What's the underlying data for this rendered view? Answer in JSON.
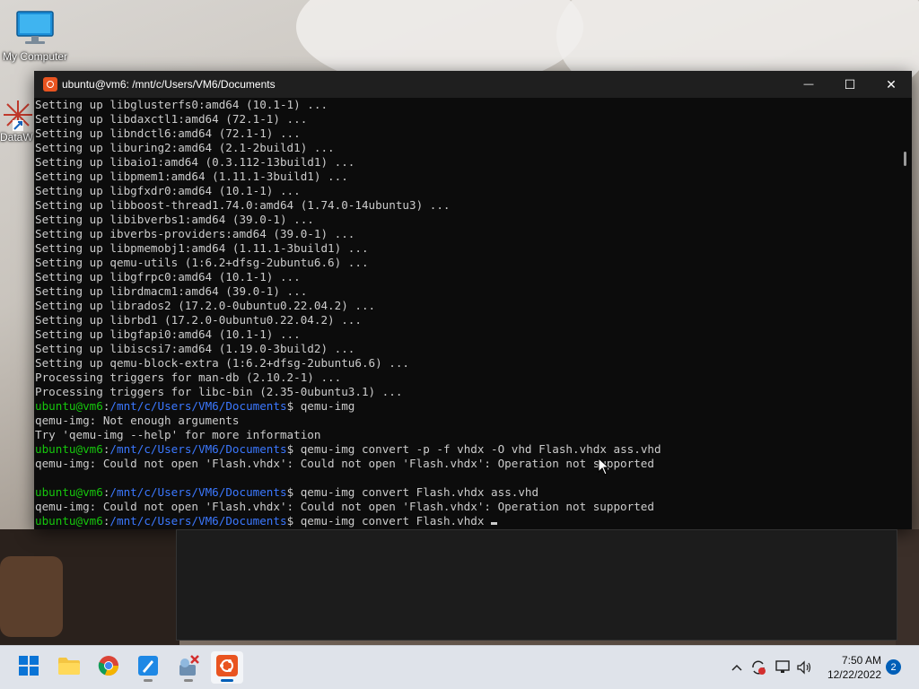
{
  "desktop": {
    "icons": [
      {
        "label": "My Computer",
        "icon": "monitor-icon"
      },
      {
        "label": "DataW",
        "icon": "app-shortcut-icon"
      }
    ]
  },
  "terminal": {
    "title": "ubuntu@vm6: /mnt/c/Users/VM6/Documents",
    "controls": {
      "minimize": "—",
      "maximize": "☐",
      "close": "✕"
    },
    "lines": [
      {
        "text": "Setting up libglusterfs0:amd64 (10.1-1) ..."
      },
      {
        "text": "Setting up libdaxctl1:amd64 (72.1-1) ..."
      },
      {
        "text": "Setting up libndctl6:amd64 (72.1-1) ..."
      },
      {
        "text": "Setting up liburing2:amd64 (2.1-2build1) ..."
      },
      {
        "text": "Setting up libaio1:amd64 (0.3.112-13build1) ..."
      },
      {
        "text": "Setting up libpmem1:amd64 (1.11.1-3build1) ..."
      },
      {
        "text": "Setting up libgfxdr0:amd64 (10.1-1) ..."
      },
      {
        "text": "Setting up libboost-thread1.74.0:amd64 (1.74.0-14ubuntu3) ..."
      },
      {
        "text": "Setting up libibverbs1:amd64 (39.0-1) ..."
      },
      {
        "text": "Setting up ibverbs-providers:amd64 (39.0-1) ..."
      },
      {
        "text": "Setting up libpmemobj1:amd64 (1.11.1-3build1) ..."
      },
      {
        "text": "Setting up qemu-utils (1:6.2+dfsg-2ubuntu6.6) ..."
      },
      {
        "text": "Setting up libgfrpc0:amd64 (10.1-1) ..."
      },
      {
        "text": "Setting up librdmacm1:amd64 (39.0-1) ..."
      },
      {
        "text": "Setting up librados2 (17.2.0-0ubuntu0.22.04.2) ..."
      },
      {
        "text": "Setting up librbd1 (17.2.0-0ubuntu0.22.04.2) ..."
      },
      {
        "text": "Setting up libgfapi0:amd64 (10.1-1) ..."
      },
      {
        "text": "Setting up libiscsi7:amd64 (1.19.0-3build2) ..."
      },
      {
        "text": "Setting up qemu-block-extra (1:6.2+dfsg-2ubuntu6.6) ..."
      },
      {
        "text": "Processing triggers for man-db (2.10.2-1) ..."
      },
      {
        "text": "Processing triggers for libc-bin (2.35-0ubuntu3.1) ..."
      },
      {
        "user": "ubuntu@vm6",
        "path": "/mnt/c/Users/VM6/Documents",
        "cmd": "$ qemu-img"
      },
      {
        "text": "qemu-img: Not enough arguments"
      },
      {
        "text": "Try 'qemu-img --help' for more information"
      },
      {
        "user": "ubuntu@vm6",
        "path": "/mnt/c/Users/VM6/Documents",
        "cmd": "$ qemu-img convert -p -f vhdx -O vhd Flash.vhdx ass.vhd"
      },
      {
        "text": "qemu-img: Could not open 'Flash.vhdx': Could not open 'Flash.vhdx': Operation not supported"
      },
      {
        "text": ""
      },
      {
        "user": "ubuntu@vm6",
        "path": "/mnt/c/Users/VM6/Documents",
        "cmd": "$ qemu-img convert Flash.vhdx ass.vhd"
      },
      {
        "text": "qemu-img: Could not open 'Flash.vhdx': Could not open 'Flash.vhdx': Operation not supported"
      },
      {
        "user": "ubuntu@vm6",
        "path": "/mnt/c/Users/VM6/Documents",
        "cmd": "$ qemu-img convert Flash.vhdx ",
        "cursor": true
      }
    ]
  },
  "taskbar": {
    "apps": [
      {
        "name": "start",
        "icon": "windows-start-icon",
        "active": false,
        "running": false
      },
      {
        "name": "file-explorer",
        "icon": "folder-icon",
        "active": false,
        "running": false
      },
      {
        "name": "chrome",
        "icon": "chrome-icon",
        "active": false,
        "running": false
      },
      {
        "name": "paint",
        "icon": "paint-icon",
        "active": false,
        "running": true
      },
      {
        "name": "tool",
        "icon": "tools-icon",
        "active": false,
        "running": true
      },
      {
        "name": "ubuntu",
        "icon": "ubuntu-icon",
        "active": true,
        "running": true
      }
    ],
    "tray": {
      "icons": [
        "chevron-up-icon",
        "sync-icon",
        "network-icon",
        "volume-icon"
      ],
      "time": "7:50 AM",
      "date": "12/22/2022",
      "notification_count": "2"
    }
  },
  "colors": {
    "terminal_bg": "#0c0c0c",
    "prompt_user": "#16c60c",
    "prompt_path": "#3b78ff",
    "ubuntu_orange": "#e95420",
    "taskbar_bg": "#dfe3ea"
  }
}
